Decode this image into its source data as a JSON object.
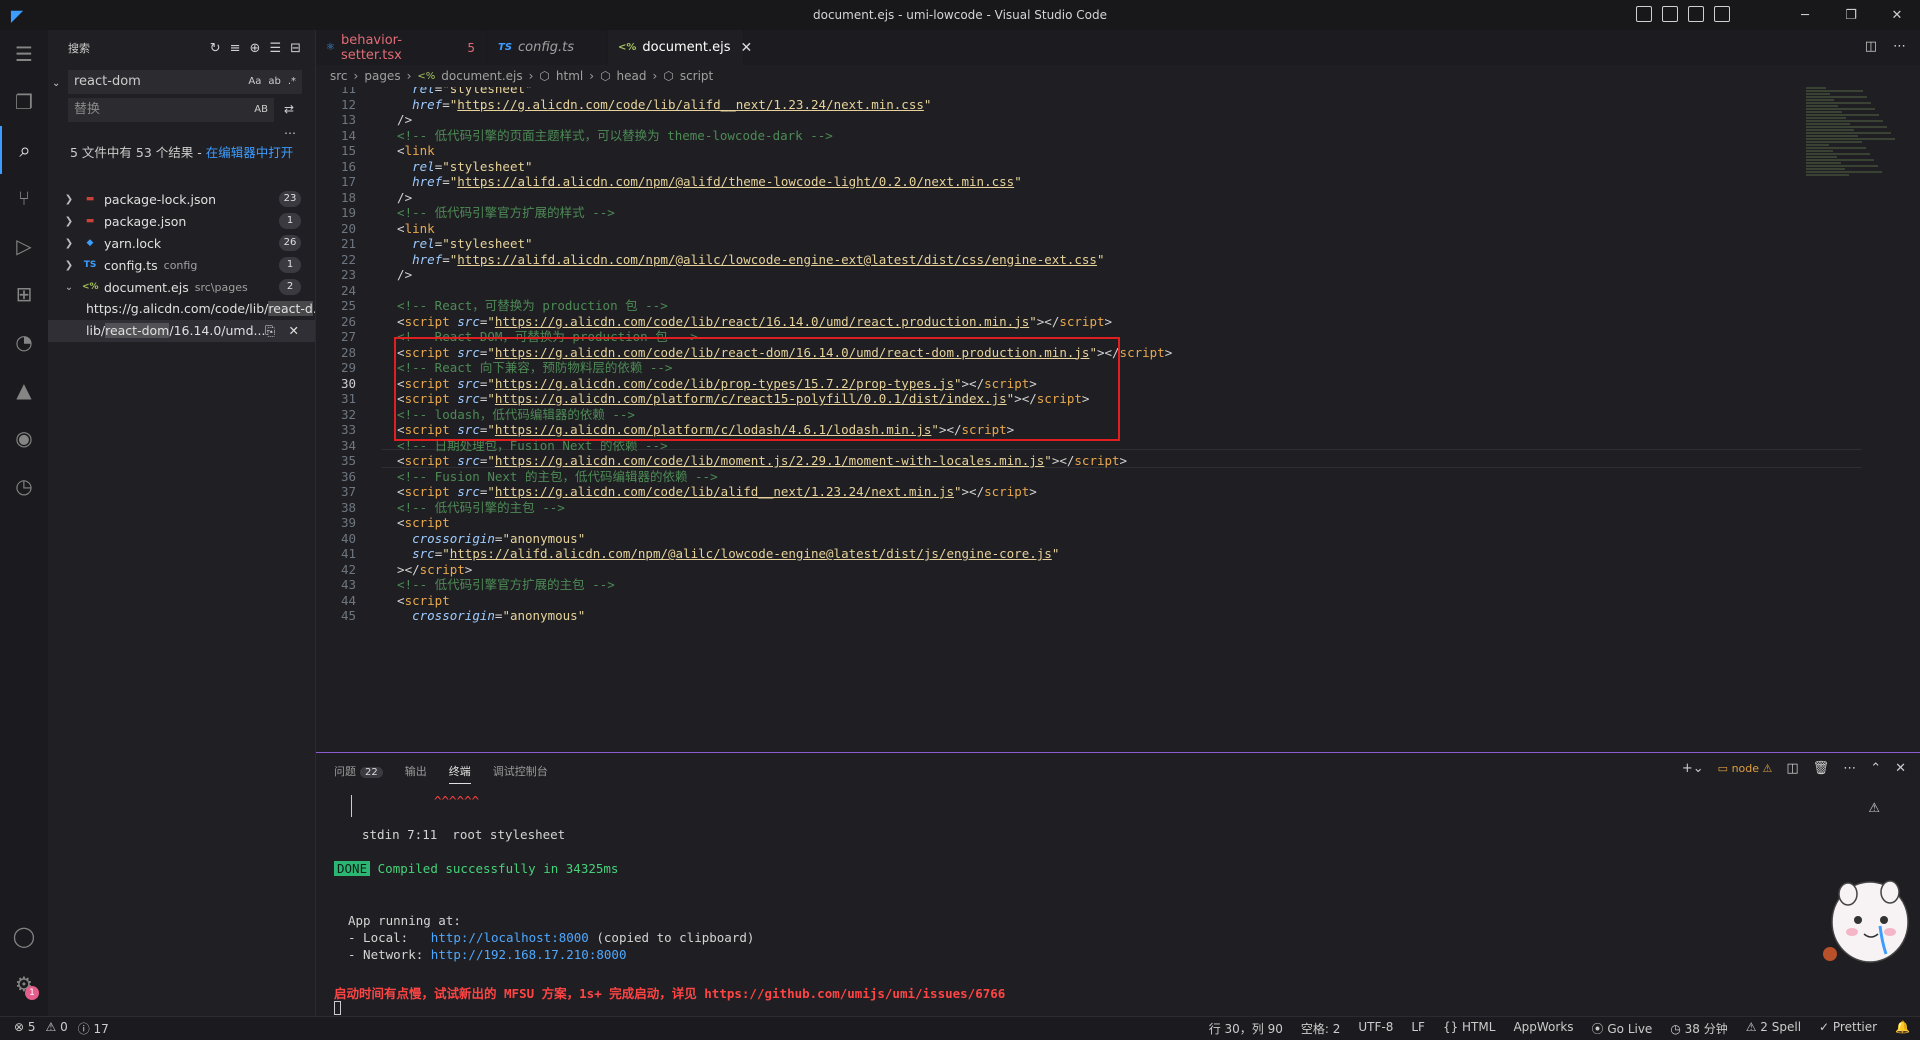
{
  "window": {
    "title": "document.ejs - umi-lowcode - Visual Studio Code"
  },
  "activity": {
    "items": [
      "explorer-icon",
      "search-icon",
      "source-control-icon",
      "run-debug-icon",
      "extensions-icon",
      "git-graph-icon",
      "deploy-icon",
      "aw-icon",
      "timeline-icon",
      "account-icon",
      "settings-icon"
    ],
    "settings_badge": "1"
  },
  "sidebar": {
    "title": "搜索",
    "search_value": "react-dom",
    "search_opts": [
      "Aa",
      "ab",
      ".*"
    ],
    "replace_placeholder": "替换",
    "replace_opt": "AB",
    "summary": "5 文件中有 53 个结果 - ",
    "summary_link": "在编辑器中打开",
    "files": [
      {
        "name": "package-lock.json",
        "path": "",
        "count": "23",
        "type": "npm"
      },
      {
        "name": "package.json",
        "path": "",
        "count": "1",
        "type": "npm"
      },
      {
        "name": "yarn.lock",
        "path": "",
        "count": "26",
        "type": "yarn"
      },
      {
        "name": "config.ts",
        "path": "config",
        "count": "1",
        "type": "ts"
      },
      {
        "name": "document.ejs",
        "path": "src\\pages",
        "count": "2",
        "type": "ejs"
      }
    ],
    "matches": [
      {
        "pre": "https://g.alicdn.com/code/lib/",
        "hit": "react-d",
        "post": "..."
      },
      {
        "pre": "lib/",
        "hit": "react-dom",
        "post": "/16.14.0/umd..."
      }
    ]
  },
  "tabs": [
    {
      "label": "behavior-setter.tsx",
      "icon": "⚛",
      "modified": "5",
      "active": false
    },
    {
      "label": "config.ts",
      "icon": "TS",
      "modified": "",
      "active": false
    },
    {
      "label": "document.ejs",
      "icon": "<%",
      "modified": "",
      "active": true
    }
  ],
  "breadcrumb": [
    "src",
    "pages",
    "document.ejs",
    "html",
    "head",
    "script"
  ],
  "editor": {
    "current_line": 30,
    "lines": [
      {
        "n": 11,
        "t": [
          [
            "pl",
            "    "
          ],
          [
            "at",
            "rel"
          ],
          [
            "pl",
            "="
          ],
          [
            "st",
            "\"stylesheet\""
          ]
        ]
      },
      {
        "n": 12,
        "t": [
          [
            "pl",
            "    "
          ],
          [
            "at",
            "href"
          ],
          [
            "pl",
            "="
          ],
          [
            "st",
            "\""
          ],
          [
            "url",
            "https://g.alicdn.com/code/lib/alifd__next/1.23.24/next.min.css"
          ],
          [
            "st",
            "\""
          ]
        ]
      },
      {
        "n": 13,
        "t": [
          [
            "pl",
            "  />"
          ]
        ]
      },
      {
        "n": 14,
        "t": [
          [
            "cm",
            "  <!-- 低代码引擎的页面主题样式，可以替换为 theme-lowcode-dark -->"
          ]
        ]
      },
      {
        "n": 15,
        "t": [
          [
            "pl",
            "  <"
          ],
          [
            "tag",
            "link"
          ]
        ]
      },
      {
        "n": 16,
        "t": [
          [
            "pl",
            "    "
          ],
          [
            "at",
            "rel"
          ],
          [
            "pl",
            "="
          ],
          [
            "st",
            "\"stylesheet\""
          ]
        ]
      },
      {
        "n": 17,
        "t": [
          [
            "pl",
            "    "
          ],
          [
            "at",
            "href"
          ],
          [
            "pl",
            "="
          ],
          [
            "st",
            "\""
          ],
          [
            "url",
            "https://alifd.alicdn.com/npm/@alifd/theme-lowcode-light/0.2.0/next.min.css"
          ],
          [
            "st",
            "\""
          ]
        ]
      },
      {
        "n": 18,
        "t": [
          [
            "pl",
            "  />"
          ]
        ]
      },
      {
        "n": 19,
        "t": [
          [
            "cm",
            "  <!-- 低代码引擎官方扩展的样式 -->"
          ]
        ]
      },
      {
        "n": 20,
        "t": [
          [
            "pl",
            "  <"
          ],
          [
            "tag",
            "link"
          ]
        ]
      },
      {
        "n": 21,
        "t": [
          [
            "pl",
            "    "
          ],
          [
            "at",
            "rel"
          ],
          [
            "pl",
            "="
          ],
          [
            "st",
            "\"stylesheet\""
          ]
        ]
      },
      {
        "n": 22,
        "t": [
          [
            "pl",
            "    "
          ],
          [
            "at",
            "href"
          ],
          [
            "pl",
            "="
          ],
          [
            "st",
            "\""
          ],
          [
            "url",
            "https://alifd.alicdn.com/npm/@alilc/lowcode-engine-ext@latest/dist/css/engine-ext.css"
          ],
          [
            "st",
            "\""
          ]
        ]
      },
      {
        "n": 23,
        "t": [
          [
            "pl",
            "  />"
          ]
        ]
      },
      {
        "n": 24,
        "t": [
          [
            "pl",
            ""
          ]
        ]
      },
      {
        "n": 25,
        "t": [
          [
            "cm",
            "  <!-- React，可替换为 production 包 -->"
          ]
        ]
      },
      {
        "n": 26,
        "t": [
          [
            "pl",
            "  <"
          ],
          [
            "tag",
            "script"
          ],
          [
            "pl",
            " "
          ],
          [
            "at",
            "src"
          ],
          [
            "pl",
            "="
          ],
          [
            "st",
            "\""
          ],
          [
            "url",
            "https://g.alicdn.com/code/lib/react/16.14.0/umd/react.production.min.js"
          ],
          [
            "st",
            "\""
          ],
          [
            "pl",
            "></"
          ],
          [
            "tag",
            "script"
          ],
          [
            "pl",
            ">"
          ]
        ]
      },
      {
        "n": 27,
        "t": [
          [
            "cm",
            "  <!-- React DOM，可替换为 production 包 -->"
          ]
        ]
      },
      {
        "n": 28,
        "t": [
          [
            "pl",
            "  <"
          ],
          [
            "tag",
            "script"
          ],
          [
            "pl",
            " "
          ],
          [
            "at",
            "src"
          ],
          [
            "pl",
            "="
          ],
          [
            "st",
            "\""
          ],
          [
            "url",
            "https://g.alicdn.com/code/lib/react-dom/16.14.0/umd/react-dom.production.min.js"
          ],
          [
            "st",
            "\""
          ],
          [
            "pl",
            "></"
          ],
          [
            "tag",
            "script"
          ],
          [
            "pl",
            ">"
          ]
        ]
      },
      {
        "n": 29,
        "t": [
          [
            "cm",
            "  <!-- React 向下兼容，预防物料层的依赖 -->"
          ]
        ]
      },
      {
        "n": 30,
        "t": [
          [
            "pl",
            "  <"
          ],
          [
            "tag",
            "script"
          ],
          [
            "pl",
            " "
          ],
          [
            "at",
            "src"
          ],
          [
            "pl",
            "="
          ],
          [
            "st",
            "\""
          ],
          [
            "url",
            "https://g.alicdn.com/code/lib/prop-types/15.7.2/prop-types.js"
          ],
          [
            "st",
            "\""
          ],
          [
            "pl",
            "></"
          ],
          [
            "tag",
            "script"
          ],
          [
            "pl",
            ">"
          ]
        ]
      },
      {
        "n": 31,
        "t": [
          [
            "pl",
            "  <"
          ],
          [
            "tag",
            "script"
          ],
          [
            "pl",
            " "
          ],
          [
            "at",
            "src"
          ],
          [
            "pl",
            "="
          ],
          [
            "st",
            "\""
          ],
          [
            "url",
            "https://g.alicdn.com/platform/c/react15-polyfill/0.0.1/dist/index.js"
          ],
          [
            "st",
            "\""
          ],
          [
            "pl",
            "></"
          ],
          [
            "tag",
            "script"
          ],
          [
            "pl",
            ">"
          ]
        ]
      },
      {
        "n": 32,
        "t": [
          [
            "cm",
            "  <!-- lodash，低代码编辑器的依赖 -->"
          ]
        ]
      },
      {
        "n": 33,
        "t": [
          [
            "pl",
            "  <"
          ],
          [
            "tag",
            "script"
          ],
          [
            "pl",
            " "
          ],
          [
            "at",
            "src"
          ],
          [
            "pl",
            "="
          ],
          [
            "st",
            "\""
          ],
          [
            "url",
            "https://g.alicdn.com/platform/c/lodash/4.6.1/lodash.min.js"
          ],
          [
            "st",
            "\""
          ],
          [
            "pl",
            "></"
          ],
          [
            "tag",
            "script"
          ],
          [
            "pl",
            ">"
          ]
        ]
      },
      {
        "n": 34,
        "t": [
          [
            "cm",
            "  <!-- 日期处理包，Fusion Next 的依赖 -->"
          ]
        ]
      },
      {
        "n": 35,
        "t": [
          [
            "pl",
            "  <"
          ],
          [
            "tag",
            "script"
          ],
          [
            "pl",
            " "
          ],
          [
            "at",
            "src"
          ],
          [
            "pl",
            "="
          ],
          [
            "st",
            "\""
          ],
          [
            "url",
            "https://g.alicdn.com/code/lib/moment.js/2.29.1/moment-with-locales.min.js"
          ],
          [
            "st",
            "\""
          ],
          [
            "pl",
            "></"
          ],
          [
            "tag",
            "script"
          ],
          [
            "pl",
            ">"
          ]
        ]
      },
      {
        "n": 36,
        "t": [
          [
            "cm",
            "  <!-- Fusion Next 的主包，低代码编辑器的依赖 -->"
          ]
        ]
      },
      {
        "n": 37,
        "t": [
          [
            "pl",
            "  <"
          ],
          [
            "tag",
            "script"
          ],
          [
            "pl",
            " "
          ],
          [
            "at",
            "src"
          ],
          [
            "pl",
            "="
          ],
          [
            "st",
            "\""
          ],
          [
            "url",
            "https://g.alicdn.com/code/lib/alifd__next/1.23.24/next.min.js"
          ],
          [
            "st",
            "\""
          ],
          [
            "pl",
            "></"
          ],
          [
            "tag",
            "script"
          ],
          [
            "pl",
            ">"
          ]
        ]
      },
      {
        "n": 38,
        "t": [
          [
            "cm",
            "  <!-- 低代码引擎的主包 -->"
          ]
        ]
      },
      {
        "n": 39,
        "t": [
          [
            "pl",
            "  <"
          ],
          [
            "tag",
            "script"
          ]
        ]
      },
      {
        "n": 40,
        "t": [
          [
            "pl",
            "    "
          ],
          [
            "at",
            "crossorigin"
          ],
          [
            "pl",
            "="
          ],
          [
            "st",
            "\"anonymous\""
          ]
        ]
      },
      {
        "n": 41,
        "t": [
          [
            "pl",
            "    "
          ],
          [
            "at",
            "src"
          ],
          [
            "pl",
            "="
          ],
          [
            "st",
            "\""
          ],
          [
            "url",
            "https://alifd.alicdn.com/npm/@alilc/lowcode-engine@latest/dist/js/engine-core.js"
          ],
          [
            "st",
            "\""
          ]
        ]
      },
      {
        "n": 42,
        "t": [
          [
            "pl",
            "  ></"
          ],
          [
            "tag",
            "script"
          ],
          [
            "pl",
            ">"
          ]
        ]
      },
      {
        "n": 43,
        "t": [
          [
            "cm",
            "  <!-- 低代码引擎官方扩展的主包 -->"
          ]
        ]
      },
      {
        "n": 44,
        "t": [
          [
            "pl",
            "  <"
          ],
          [
            "tag",
            "script"
          ]
        ]
      },
      {
        "n": 45,
        "t": [
          [
            "pl",
            "    "
          ],
          [
            "at",
            "crossorigin"
          ],
          [
            "pl",
            "="
          ],
          [
            "st",
            "\"anonymous\""
          ]
        ]
      }
    ]
  },
  "panel": {
    "tabs": [
      {
        "label": "问题",
        "badge": "22",
        "active": false
      },
      {
        "label": "输出",
        "badge": "",
        "active": false
      },
      {
        "label": "终端",
        "badge": "",
        "active": true
      },
      {
        "label": "调试控制台",
        "badge": "",
        "active": false
      }
    ],
    "terminal_name": "node",
    "terminal": {
      "carets": "^^^^^^",
      "stdin": "stdin 7:11  root stylesheet",
      "done_tag": "DONE",
      "done_msg": "Compiled successfully in 34325ms",
      "app_running": "App running at:",
      "local_label": "- Local:   ",
      "local_url": "http://localhost:8000",
      "local_note": " (copied to clipboard)",
      "network_label": "- Network: ",
      "network_url": "http://192.168.17.210:8000",
      "mfsu_msg": "启动时间有点慢，试试新出的 MFSU 方案，1s+ 完成启动，详见 https://github.com/umijs/umi/issues/6766"
    }
  },
  "statusbar": {
    "left": [
      "⊗ 5",
      "⚠ 0",
      "ⓘ 17"
    ],
    "right": [
      "行 30，列 90",
      "空格: 2",
      "UTF-8",
      "LF",
      "{} HTML",
      "AppWorks",
      "Go Live",
      "38 分钟",
      "2 Spell",
      "Prettier"
    ]
  }
}
